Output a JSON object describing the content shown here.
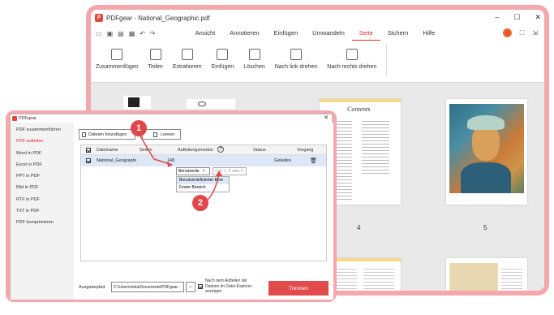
{
  "app": {
    "title": "PDFgear - National_Geographic.pdf",
    "logo_text": "P",
    "window_controls": [
      "–",
      "☐",
      "✕"
    ]
  },
  "menu": {
    "items": [
      "Ansicht",
      "Annotieren",
      "Einfügen",
      "Umwandeln",
      "Seite",
      "Sichern",
      "Hilfe"
    ],
    "active": "Seite"
  },
  "ribbon": {
    "buttons": [
      "Zusammenfügen",
      "Teilen",
      "Extrahieren",
      "Einfügen",
      "Löschen",
      "Nach link drehen",
      "Nach rechts drehen"
    ]
  },
  "pages": {
    "numbers": [
      "4",
      "5"
    ],
    "contents_title": "Contents"
  },
  "dialog": {
    "title": "PDFgear",
    "close": "✕",
    "sidebar": [
      "PDF zusammenführen",
      "PDF aufteilen",
      "Word in PDF",
      "Excel in PDF",
      "PPT in PDF",
      "Bild in PDF",
      "RTF in PDF",
      "TXT in PDF",
      "PDF komprimieren"
    ],
    "sidebar_active": "PDF aufteilen",
    "add_files": "Dateien hinzufügen",
    "clear": "Leeren",
    "columns": [
      "Dateiname",
      "Seiten",
      "Aufteilungsmodus",
      "Status",
      "Vorgang"
    ],
    "help_icon": "?",
    "row": {
      "filename": "National_Geographi",
      "pages": "148",
      "mode": "Benutzerde",
      "pages_placeholder": "2, 8, 1, 8 oder 5",
      "status": "Geladen"
    },
    "dropdown_options": [
      "Benutzerdefinierter Bere",
      "Fester Bereich"
    ],
    "output_label": "Ausgabepfad",
    "output_path": "C:\\Users\\viola\\Documents\\PDFgear",
    "browse": "...",
    "open_after_label": "Nach dem Aufteilen der Dateien im Datei-Explorer anzeigen",
    "split_button": "Trennen"
  },
  "annotations": {
    "badge1": "1",
    "badge2": "2",
    "color": "#e1474a"
  }
}
